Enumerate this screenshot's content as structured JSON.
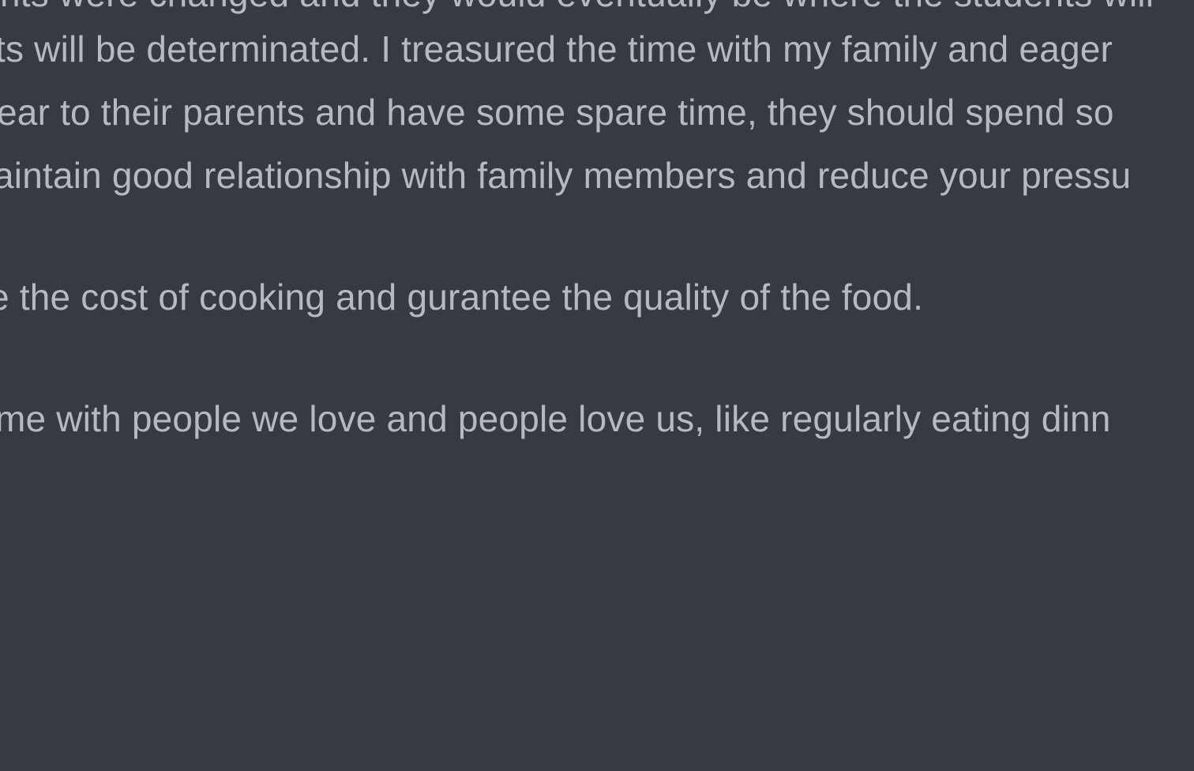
{
  "document": {
    "background": "#373a3f",
    "text_color": "#b6b9bf",
    "lines": [
      "nts were changed and they would eventually be where the students will",
      "ts will be determinated. I treasured the time with my family and eager",
      "ear to their parents and have some spare time, they should spend so",
      "aintain good relationship with family members and reduce your pressu",
      "e the cost of cooking and gurantee the quality of the food.",
      "me with people we love and people love us, like regularly eating dinn"
    ]
  }
}
